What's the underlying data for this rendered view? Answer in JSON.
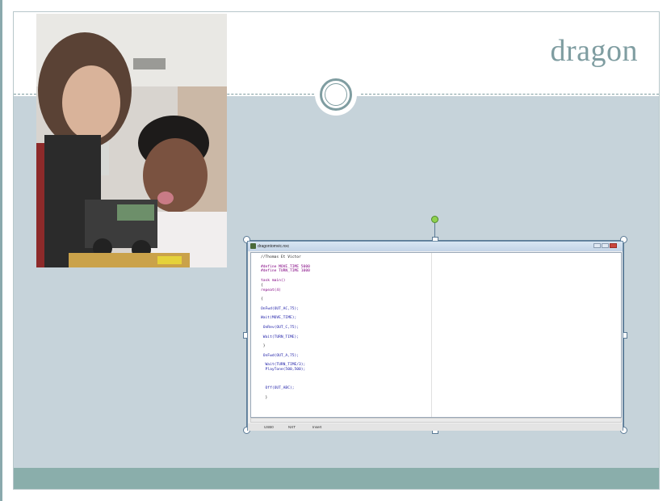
{
  "slide": {
    "title": "dragon"
  },
  "colors": {
    "accent": "#7f9da1",
    "content_bg": "#c6d3da",
    "footer_bg": "#8aaeab"
  },
  "screenshot": {
    "window_title": "dragontomvic.nxc",
    "code_lines": [
      "//Thomas Et Victor",
      "",
      "#define MOVE_TIME 5000",
      "#define TURN_TIME 1000",
      "",
      "task main()",
      "{",
      "repeat(4)",
      "",
      "{",
      "",
      "OnFwd(OUT_AC,75);",
      "",
      "Wait(MOVE_TIME);",
      "",
      " OnRev(OUT_C,75);",
      "",
      " Wait(TURN_TIME);",
      "",
      " }",
      "",
      " OnFwd(OUT_A,75);",
      "",
      "  Wait(TURN_TIME/3);",
      "  PlayTone(500,500);",
      "",
      "",
      "",
      "  Off(OUT_ABC);",
      "",
      "  }"
    ],
    "status": {
      "port": "USB0",
      "device": "NXT",
      "mode": "Insert"
    }
  }
}
